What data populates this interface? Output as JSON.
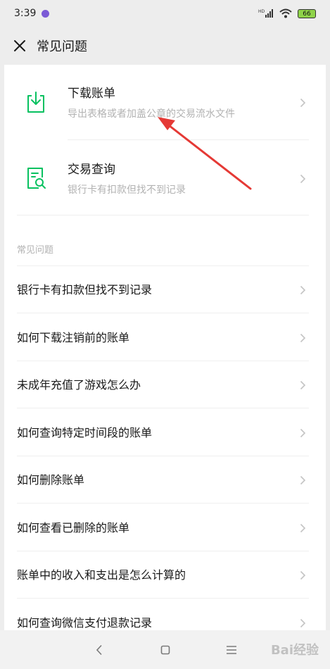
{
  "status_bar": {
    "time": "3:39",
    "network": "HD",
    "battery": "66"
  },
  "header": {
    "title": "常见问题"
  },
  "features": [
    {
      "title": "下载账单",
      "desc": "导出表格或者加盖公章的交易流水文件"
    },
    {
      "title": "交易查询",
      "desc": "银行卡有扣款但找不到记录"
    }
  ],
  "faq": {
    "section_label": "常见问题",
    "items": [
      "银行卡有扣款但找不到记录",
      "如何下载注销前的账单",
      "未成年充值了游戏怎么办",
      "如何查询特定时间段的账单",
      "如何删除账单",
      "如何查看已删除的账单",
      "账单中的收入和支出是怎么计算的",
      "如何查询微信支付退款记录"
    ]
  },
  "watermark": {
    "text": "Bai经验"
  },
  "colors": {
    "accent": "#07c160",
    "arrow": "#e53935",
    "muted": "#b2b2b2"
  }
}
